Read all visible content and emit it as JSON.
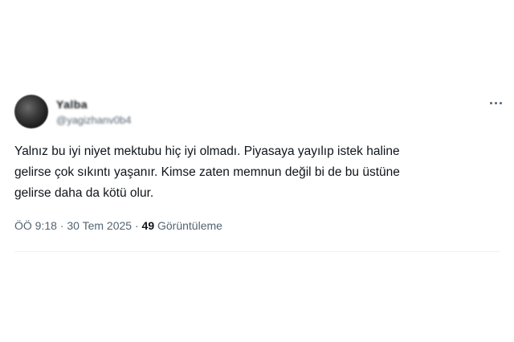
{
  "author": {
    "name": "Yalba",
    "handle": "@yagizhanv0b4"
  },
  "tweet": {
    "lines": [
      "Yalnız bu iyi niyet mektubu hiç iyi olmadı. Piyasaya yayılıp istek haline",
      "gelirse çok sıkıntı yaşanır. Kimse zaten memnun değil bi de bu üstüne",
      "gelirse daha da kötü olur."
    ]
  },
  "meta": {
    "time": "ÖÖ 9:18",
    "separator1": " · ",
    "date": "30 Tem 2025",
    "separator2": " · ",
    "views_count": "49",
    "views_label": " Görüntüleme"
  },
  "icons": {
    "more": "more-horizontal-icon"
  }
}
